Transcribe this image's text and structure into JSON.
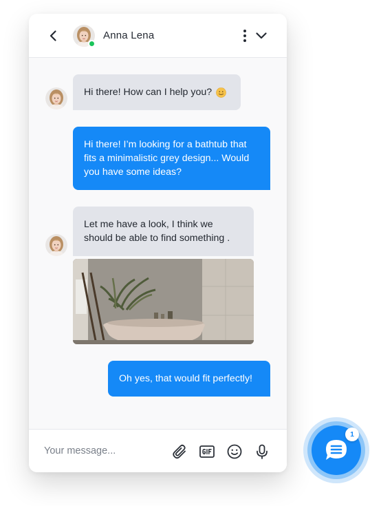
{
  "header": {
    "contact_name": "Anna Lena",
    "status": "online",
    "icons": [
      "chevron-left-icon",
      "more-vertical-icon",
      "chevron-down-icon"
    ]
  },
  "messages": [
    {
      "from": "agent",
      "text": "Hi there! How can I help you?",
      "emoji": "slightly-smiling-face"
    },
    {
      "from": "user",
      "lines": [
        "Hi there! I’m looking for a bathtub that",
        "fits a minimalistic grey design... Would",
        "you have some ideas?"
      ]
    },
    {
      "from": "agent",
      "lines": [
        "Let me have a look, I think we",
        "should be able to find something ."
      ],
      "attachment": "bathroom-photo"
    },
    {
      "from": "user",
      "text": "Oh yes, that would fit perfectly!"
    }
  ],
  "composer": {
    "placeholder": "Your message...",
    "value": "",
    "tools": [
      "paperclip-icon",
      "gif-icon",
      "smiley-icon",
      "microphone-icon"
    ]
  },
  "launcher": {
    "unread_count": "1"
  },
  "colors": {
    "accent": "#1589f7",
    "agent_bubble": "#e2e4ea",
    "online": "#1bc45b",
    "background": "#f9f9fa"
  }
}
